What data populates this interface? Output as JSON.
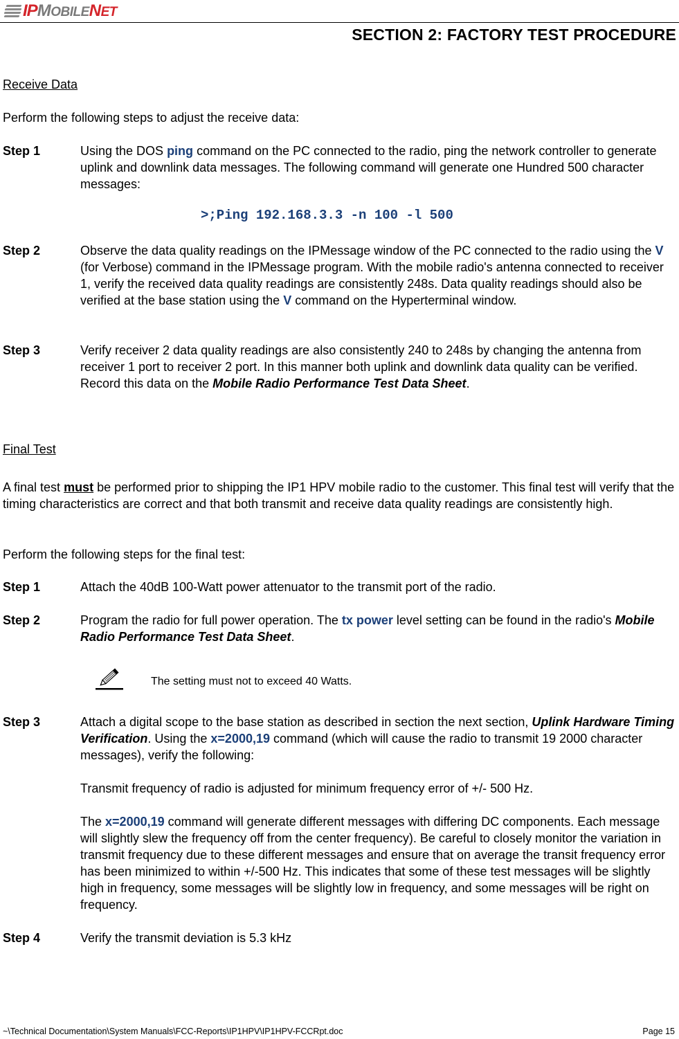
{
  "header": {
    "logo": {
      "ip": "IP",
      "mobile_first": "M",
      "mobile_rest": "OBILE",
      "net_first": "N",
      "net_rest": "ET"
    },
    "section_title": "SECTION 2:  FACTORY TEST PROCEDURE"
  },
  "receive_data": {
    "heading": "Receive Data",
    "intro": "Perform the following steps to adjust the receive data:",
    "steps": [
      {
        "label": "Step 1",
        "t1": "Using the DOS ",
        "h1": "ping",
        "t2": " command on the PC connected to the radio, ping the network controller to generate uplink and downlink data messages.  The following command will generate one Hundred 500 character messages:",
        "command": ">;Ping 192.168.3.3 -n 100 -l 500"
      },
      {
        "label": "Step 2",
        "t1": "Observe the data quality readings on the IPMessage window of the PC connected to the radio using the ",
        "h1": "V",
        "t2": " (for Verbose) command in the IPMessage program.  With the mobile radio's antenna connected to receiver 1, verify the received data quality readings are consistently 248s.  Data quality readings should also be verified at the base station using the ",
        "h2": "V",
        "t3": " command on the Hyperterminal window."
      },
      {
        "label": "Step 3",
        "t1": "Verify receiver 2 data quality readings are also consistently 240 to 248s by changing the antenna from receiver 1 port to receiver 2 port.  In this manner both uplink and downlink data quality can be verified.  Record this data on the ",
        "b1": "Mobile Radio Performance Test Data Sheet",
        "t2": "."
      }
    ]
  },
  "final_test": {
    "heading": "Final Test",
    "intro_t1": "A final test ",
    "intro_must": "must",
    "intro_t2": " be performed prior to shipping the IP1 HPV mobile radio to the customer.  This final test will verify that the timing characteristics are correct and that both transmit and receive data quality readings are consistently high.",
    "intro2": "Perform the following steps for the final test:",
    "steps": [
      {
        "label": "Step 1",
        "t1": "Attach the 40dB 100-Watt power attenuator to the transmit port of the radio."
      },
      {
        "label": "Step 2",
        "t1": "Program the radio for full power operation.  The ",
        "h1": "tx power",
        "t2": " level setting can be found in the radio's ",
        "b1": "Mobile Radio Performance Test Data Sheet",
        "t3": "."
      },
      {
        "label": "Step 3",
        "t1": "Attach a digital scope to the base station as described in section the next section, ",
        "b1": "Uplink Hardware Timing Verification",
        "t2": ".  Using the ",
        "h1": "x=2000,19",
        "t3": " command (which will cause the radio to transmit 19 2000 character messages), verify the following:",
        "p2": "Transmit frequency of radio is adjusted for minimum frequency error of +/- 500 Hz.",
        "p3_t1": "The ",
        "p3_h1": "x=2000,19",
        "p3_t2": " command will generate different messages with differing DC components. Each message will slightly slew the frequency off from the center frequency). Be careful to closely monitor the variation in transmit frequency due to these different messages and ensure that on average the transit frequency error has been minimized to within +/-500 Hz. This indicates that some of these test messages will be slightly high in frequency, some messages will be slightly low in frequency, and some messages will be right on frequency."
      },
      {
        "label": "Step 4",
        "t1": "Verify the transmit deviation is 5.3 kHz"
      }
    ],
    "note": {
      "icon": "pencil-icon",
      "text": "The setting must not to exceed 40 Watts."
    }
  },
  "footer": {
    "path": "~\\Technical Documentation\\System Manuals\\FCC-Reports\\IP1HPV\\IP1HPV-FCCRpt.doc",
    "page": "Page 15"
  },
  "colors": {
    "highlight": "#1b3f78",
    "logo_red": "#d4242a",
    "logo_gray": "#7a7a7a"
  }
}
